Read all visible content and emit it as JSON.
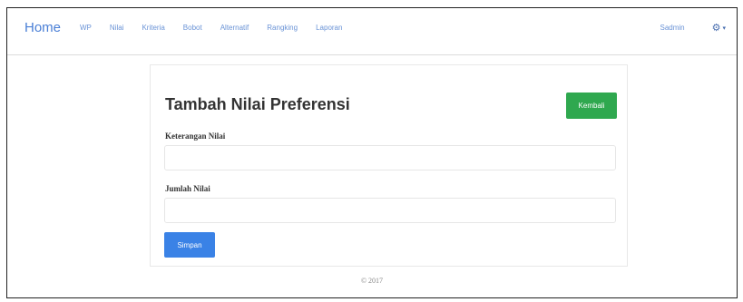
{
  "navbar": {
    "brand": "Home",
    "links": [
      "WP",
      "Nilai",
      "Kriteria",
      "Bobot",
      "Alternatif",
      "Rangking",
      "Laporan"
    ],
    "user": "Sadmin",
    "settings_icon": "gear-icon",
    "caret_icon": "chevron-down-icon"
  },
  "form": {
    "title": "Tambah Nilai Preferensi",
    "back_label": "Kembali",
    "field1_label": "Keterangan Nilai",
    "field1_value": "",
    "field2_label": "Jumlah Nilai",
    "field2_value": "",
    "save_label": "Simpan"
  },
  "footer": {
    "text": "© 2017"
  },
  "colors": {
    "brand": "#4a7fd6",
    "back_button": "#2fa84f",
    "save_button": "#3a82e6"
  }
}
